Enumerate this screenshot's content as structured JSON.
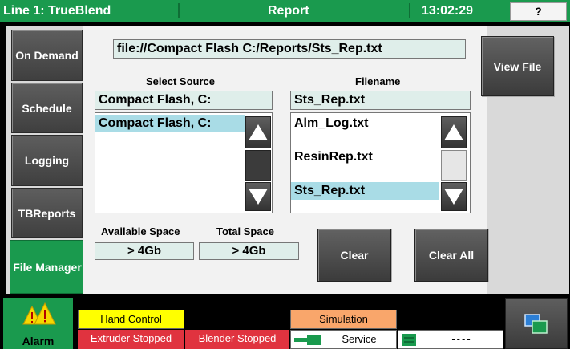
{
  "header": {
    "title": "Line 1: TrueBlend",
    "screen_name": "Report",
    "time": "13:02:29",
    "help_label": "?"
  },
  "nav": {
    "items": [
      {
        "label": "On Demand"
      },
      {
        "label": "Schedule"
      },
      {
        "label": "Logging"
      },
      {
        "label": "TBReports"
      },
      {
        "label": "File Manager"
      }
    ]
  },
  "file_manager": {
    "path": "file://Compact Flash C:/Reports/Sts_Rep.txt",
    "view_file_label": "View File",
    "select_source_label": "Select Source",
    "filename_label": "Filename",
    "source_value": "Compact Flash, C:",
    "source_list": [
      "Compact Flash, C:"
    ],
    "filename_value": "Sts_Rep.txt",
    "file_list": [
      "Alm_Log.txt",
      "ResinRep.txt",
      "Sts_Rep.txt"
    ],
    "available_space_label": "Available Space",
    "total_space_label": "Total Space",
    "available_space": "> 4Gb",
    "total_space": "> 4Gb",
    "clear_label": "Clear",
    "clear_all_label": "Clear All"
  },
  "footer": {
    "alarm_label": "Alarm",
    "hand_control": "Hand Control",
    "simulation": "Simulation",
    "extruder_status": "Extruder Stopped",
    "blender_status": "Blender Stopped",
    "service": "Service",
    "placeholder": "----"
  },
  "colors": {
    "accent_green": "#1a9a4e",
    "selection": "#a9dce6",
    "field_bg": "#dfeeea",
    "status_yellow": "#ffff00",
    "status_orange": "#f9a66b",
    "status_red": "#e0333f"
  },
  "icons": {
    "alarm": "warning-triangles-icon",
    "scroll_up": "triangle-up-icon",
    "scroll_down": "triangle-down-icon",
    "screen_switch": "screen-switch-icon"
  }
}
